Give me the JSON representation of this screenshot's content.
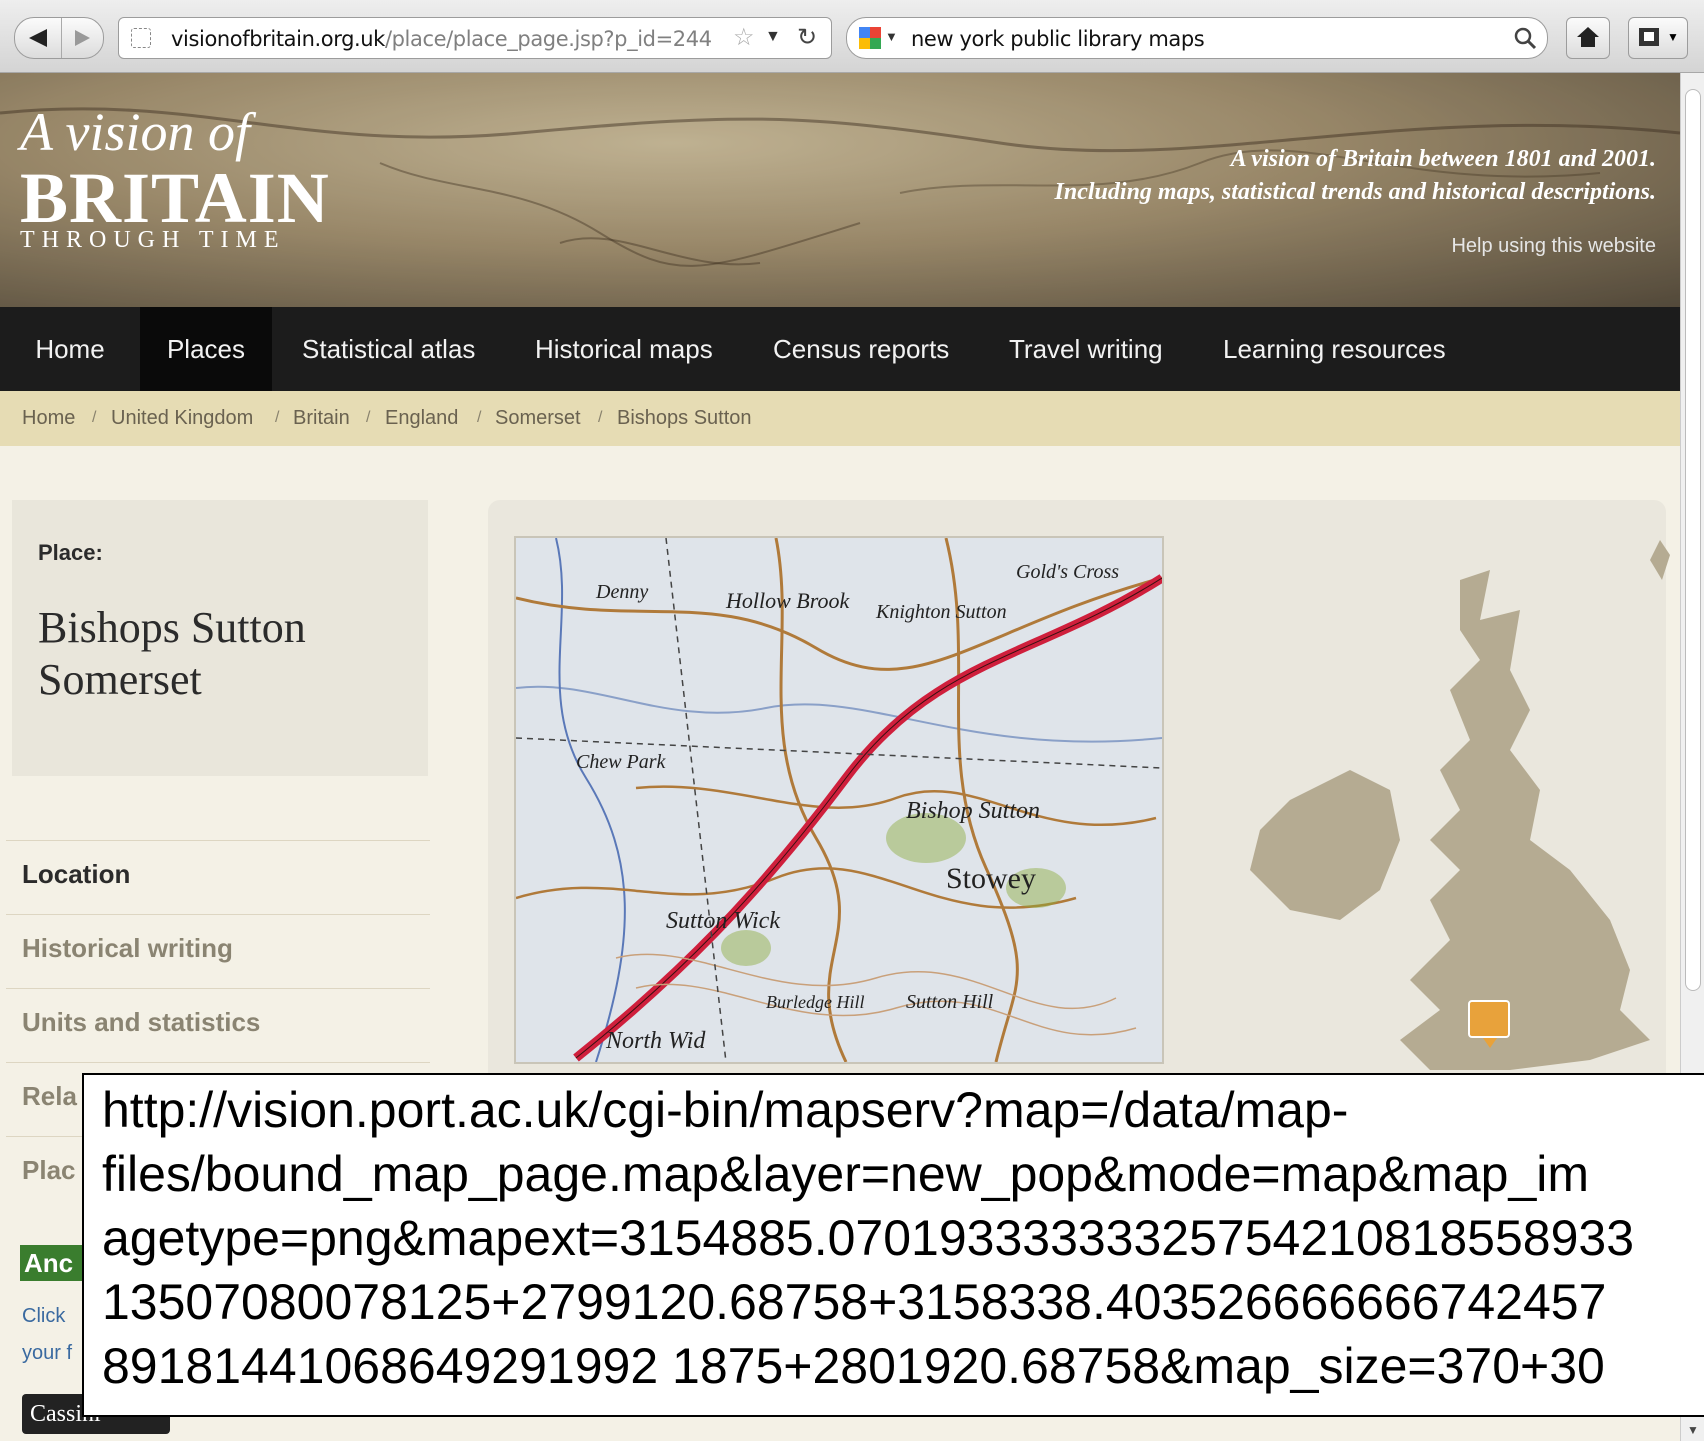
{
  "browser": {
    "url_domain": "visionofbritain.org.uk",
    "url_path": "/place/place_page.jsp?p_id=244",
    "search_query": "new york public library maps"
  },
  "header": {
    "logo_line1": "A vision of",
    "logo_line2": "BRITAIN",
    "logo_line3": "THROUGH TIME",
    "tagline_line1": "A vision of Britain between 1801 and 2001.",
    "tagline_line2": "Including maps, statistical trends and historical descriptions.",
    "help_link": "Help using this website"
  },
  "nav": {
    "items": [
      "Home",
      "Places",
      "Statistical atlas",
      "Historical maps",
      "Census reports",
      "Travel writing",
      "Learning resources"
    ],
    "active": "Places"
  },
  "breadcrumb": [
    "Home",
    "United Kingdom",
    "Britain",
    "England",
    "Somerset",
    "Bishops Sutton"
  ],
  "place": {
    "label": "Place:",
    "name": "Bishops Sutton",
    "county": "Somerset"
  },
  "sidenav": {
    "items": [
      "Location",
      "Historical writing",
      "Units and statistics",
      "Rela",
      "Plac"
    ]
  },
  "sidebar_extra": {
    "badge": "Anc",
    "click_text": "Click",
    "your_text": "your f",
    "cassini_logo": "Cassini"
  },
  "map_labels": {
    "hollow_brook": "Hollow Brook",
    "knighton_sutton": "Knighton Sutton",
    "chew_park": "Chew Park",
    "bishop_sutton": "Bishop Sutton",
    "stowey": "Stowey",
    "sutton_wick": "Sutton Wick",
    "burledge_hill": "Burledge Hill",
    "sutton_hill": "Sutton Hill",
    "north_wid": "North Wid",
    "golds_cross": "Gold's Cross",
    "denny": "Denny"
  },
  "overlay": {
    "lines": [
      "http://vision.port.ac.uk/cgi-bin/mapserv?map=/data/map-",
      "files/bound_map_page.map&layer=new_pop&mode=map&map_im",
      "agetype=png&mapext=3154885.07019333333325754210818558933",
      "13507080078125+2799120.68758+3158338.403526666666742457",
      "89181441068649291992 1875+2801920.68758&map_size=370+30"
    ]
  },
  "colors": {
    "nav_bg": "#1c1c1c",
    "breadcrumb_bg": "#e6dcb4",
    "page_bg": "#f4f1e6",
    "marker": "#e8a23b",
    "road_red": "#cf1f3c"
  }
}
